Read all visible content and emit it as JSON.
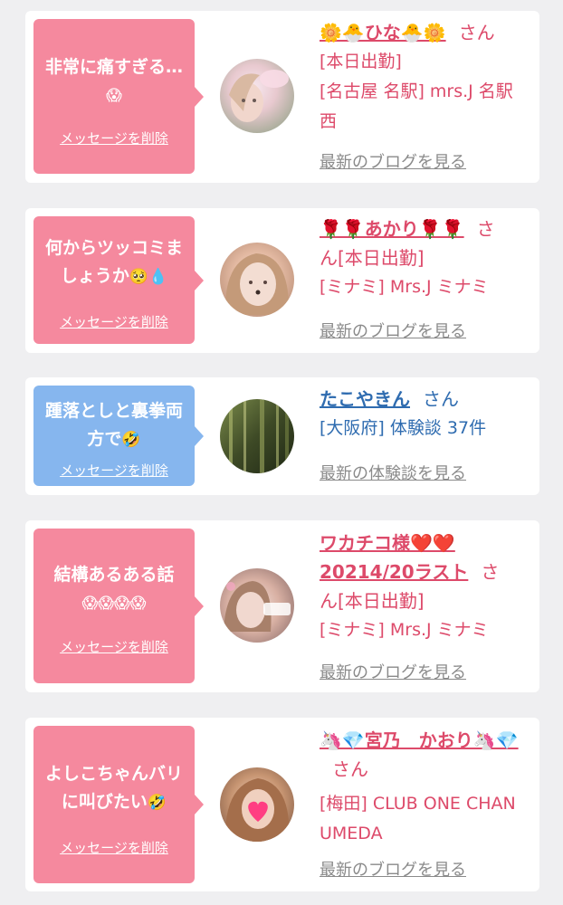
{
  "cards": [
    {
      "message": "非常に痛すぎる…",
      "message_icon": "😱",
      "delete_label": "メッセージを削除",
      "name": "🌼🐣ひな🐣🌼",
      "honorific": "さん",
      "status": "[本日出勤]",
      "shop": "[名古屋 名駅] mrs.J 名駅西",
      "link": "最新のブログを見る"
    },
    {
      "message": "何からツッコミましょうか",
      "message_icon": "🥺💧",
      "delete_label": "メッセージを削除",
      "name": "🌹🌹あかり🌹🌹",
      "honorific": "さ",
      "honorific_cont": "ん[本日出勤]",
      "shop": "[ミナミ] Mrs.J ミナミ",
      "link": "最新のブログを見る"
    },
    {
      "message": "踵落としと裏拳両方で",
      "message_icon": "🤣",
      "delete_label": "メッセージを削除",
      "name": "たこやきん",
      "honorific": "さん",
      "shop": "[大阪府] 体験談 37件",
      "link": "最新の体験談を見る"
    },
    {
      "message": "結構あるある話",
      "message_icon": "😱😱😱😱",
      "delete_label": "メッセージを削除",
      "name": "ワカチコ様❤️❤️20214/20ラスト",
      "honorific": "さ",
      "honorific_cont": "ん[本日出勤]",
      "shop": "[ミナミ] Mrs.J ミナミ",
      "link": "最新のブログを見る"
    },
    {
      "message": "よしこちゃんバリに叫びたい",
      "message_icon": "🤣",
      "delete_label": "メッセージを削除",
      "name": "🦄💎宮乃　かおり🦄💎",
      "honorific": "さん",
      "shop": "[梅田] CLUB ONE CHAN UMEDA",
      "link": "最新のブログを見る"
    }
  ],
  "colors": {
    "bubble_pink": "#f5899e",
    "bubble_blue": "#86b6ee",
    "text_pink": "#dd4a6a",
    "text_blue": "#2f6cb0",
    "link_gray": "#8a8a8a",
    "background": "#efeff1"
  }
}
